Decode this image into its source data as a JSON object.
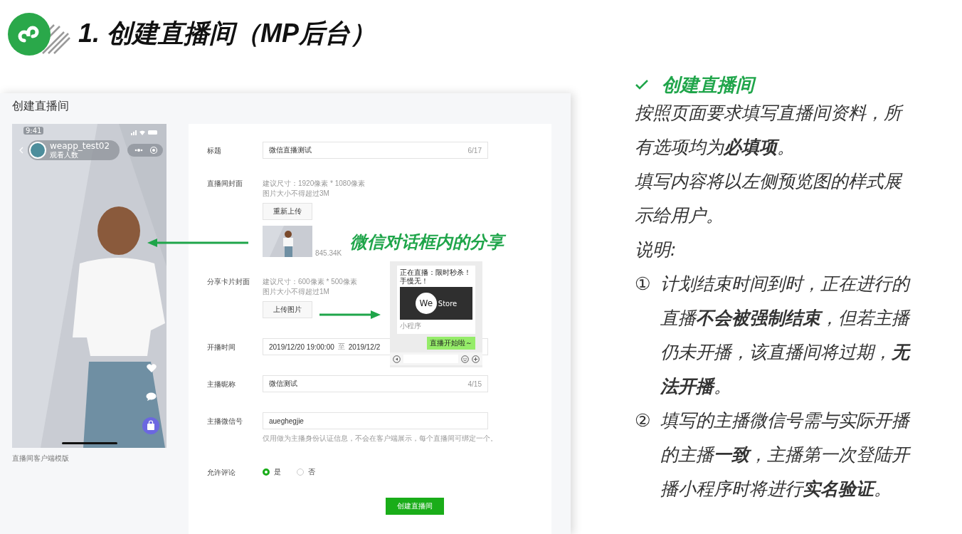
{
  "slide_title": "1. 创建直播间（MP后台）",
  "screenshot": {
    "page_title": "创建直播间",
    "preview": {
      "kind": "picture",
      "time": "9:41",
      "account": "weapp_test02",
      "viewers": "观看人数",
      "caption": "直播间客户端模版"
    },
    "fields": [
      {
        "kind": "text",
        "label": "标题",
        "value": "微信直播测试",
        "counter": "6/17"
      },
      {
        "kind": "upload",
        "label": "直播间封面",
        "hints": [
          "建议尺寸：1920像素 * 1080像素",
          "图片大小不得超过3M"
        ],
        "button": "重新上传",
        "file_size": "845.34K"
      },
      {
        "kind": "upload",
        "label": "分享卡片封面",
        "hints": [
          "建议尺寸：600像素 * 500像素",
          "图片大小不得超过1M"
        ],
        "button": "上传图片"
      },
      {
        "kind": "daterange",
        "label": "开播时间",
        "start": "2019/12/20 19:00:00",
        "separator": "至",
        "end": "2019/12/2"
      },
      {
        "kind": "text",
        "label": "主播昵称",
        "value": "微信测试",
        "counter": "4/15"
      },
      {
        "kind": "text",
        "label": "主播微信号",
        "value": "aueghegjie",
        "help": "仅用做为主播身份认证信息，不会在客户端展示，每个直播间可绑定一个。"
      },
      {
        "kind": "radio",
        "label": "允许评论",
        "options": [
          {
            "label": "是",
            "selected": true
          },
          {
            "label": "否",
            "selected": false
          }
        ]
      }
    ],
    "submit": "创建直播间"
  },
  "share_caption": "微信对话框内的分享",
  "chat": {
    "card_title": "正在直播：限时秒杀！手慢无！",
    "logo_we": "We",
    "logo_store": "Store",
    "source": "小程序",
    "message": "直播开始啦～"
  },
  "notes": {
    "heading": "创建直播间",
    "paragraphs": [
      "按照页面要求填写直播间资料，所有选项均为**必填项**。",
      "填写内容将以左侧预览图的样式展示给用户。",
      "说明:"
    ],
    "items": [
      {
        "marker": "①",
        "text": "计划结束时间到时，正在进行的直播**不会被强制结束**，但若主播仍未开播，该直播间将过期，**无法开播**。"
      },
      {
        "marker": "②",
        "text": "填写的主播微信号需与实际开播的主播**一致**，主播第一次登陆开播小程序时将进行**实名验证**。"
      }
    ]
  }
}
